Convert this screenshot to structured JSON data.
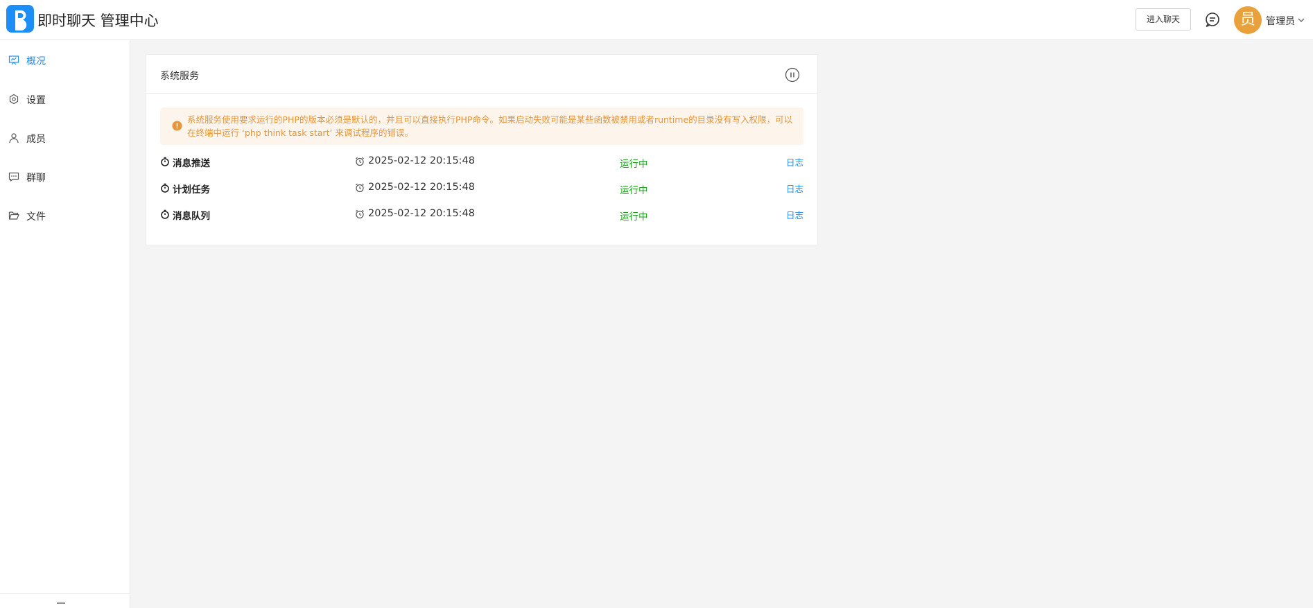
{
  "header": {
    "app_title": "即时聊天 管理中心",
    "enter_chat_label": "进入聊天",
    "avatar_text": "员",
    "user_name": "管理员",
    "colors": {
      "brand": "#1e8ef7",
      "avatar": "#e9a23b"
    }
  },
  "sidebar": {
    "items": [
      {
        "label": "概况",
        "icon": "presentation-chart-icon",
        "active": true
      },
      {
        "label": "设置",
        "icon": "gear-icon",
        "active": false
      },
      {
        "label": "成员",
        "icon": "user-icon",
        "active": false
      },
      {
        "label": "群聊",
        "icon": "chat-dots-icon",
        "active": false
      },
      {
        "label": "文件",
        "icon": "folder-open-icon",
        "active": false
      }
    ]
  },
  "card": {
    "title": "系统服务",
    "alert_text": "系统服务使用要求运行的PHP的版本必须是默认的，并且可以直接执行PHP命令。如果启动失败可能是某些函数被禁用或者runtime的目录没有写入权限，可以在终端中运行 ‘php think task start’ 来调试程序的错误。",
    "services": [
      {
        "name": "消息推送",
        "time": "2025-02-12 20:15:48",
        "status": "运行中",
        "log_label": "日志"
      },
      {
        "name": "计划任务",
        "time": "2025-02-12 20:15:48",
        "status": "运行中",
        "log_label": "日志"
      },
      {
        "name": "消息队列",
        "time": "2025-02-12 20:15:48",
        "status": "运行中",
        "log_label": "日志"
      }
    ],
    "colors": {
      "alert_bg": "#fdf5ec",
      "alert_text": "#e6953a",
      "status": "#1aa01a",
      "link": "#1e8ef7"
    }
  }
}
